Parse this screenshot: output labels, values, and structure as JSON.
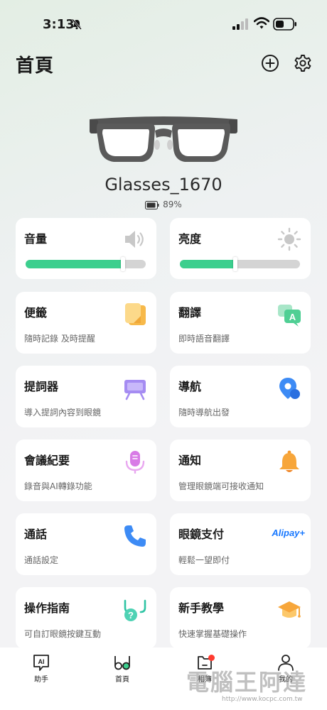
{
  "status_bar": {
    "time": "3:13"
  },
  "header": {
    "title": "首頁"
  },
  "device": {
    "name": "Glasses_1670",
    "battery": "89%"
  },
  "sliders": {
    "volume": {
      "label": "音量",
      "level": 0.81
    },
    "brightness": {
      "label": "亮度",
      "level": 0.46
    }
  },
  "cards": [
    {
      "title": "便籤",
      "subtitle": "隨時記錄 及時提醒",
      "icon": "notes-icon"
    },
    {
      "title": "翻譯",
      "subtitle": "即時語音翻譯",
      "icon": "translate-icon"
    },
    {
      "title": "提詞器",
      "subtitle": "導入提詞內容到眼鏡",
      "icon": "teleprompter-icon"
    },
    {
      "title": "導航",
      "subtitle": "隨時導航出發",
      "icon": "navigation-icon"
    },
    {
      "title": "會議紀要",
      "subtitle": "錄音與AI轉錄功能",
      "icon": "microphone-icon"
    },
    {
      "title": "通知",
      "subtitle": "管理眼鏡端可接收通知",
      "icon": "bell-icon"
    },
    {
      "title": "通話",
      "subtitle": "通話設定",
      "icon": "phone-icon"
    },
    {
      "title": "眼鏡支付",
      "subtitle": "輕鬆一望即付",
      "icon": "alipay-logo",
      "logo_text": "Alipay+"
    },
    {
      "title": "操作指南",
      "subtitle": "可自訂眼鏡按鍵互動",
      "icon": "help-glasses-icon"
    },
    {
      "title": "新手教學",
      "subtitle": "快速掌握基礎操作",
      "icon": "graduation-cap-icon"
    }
  ],
  "tabs": [
    {
      "label": "助手",
      "icon": "ai-assistant-icon"
    },
    {
      "label": "首頁",
      "icon": "glasses-icon"
    },
    {
      "label": "相簿",
      "icon": "album-icon"
    },
    {
      "label": "我的",
      "icon": "profile-icon"
    }
  ],
  "watermark": {
    "text": "電腦王阿達",
    "url": "http://www.kocpc.com.tw"
  },
  "colors": {
    "accent": "#3ccf8e",
    "background": "#f3f3f5",
    "card": "#ffffff"
  }
}
